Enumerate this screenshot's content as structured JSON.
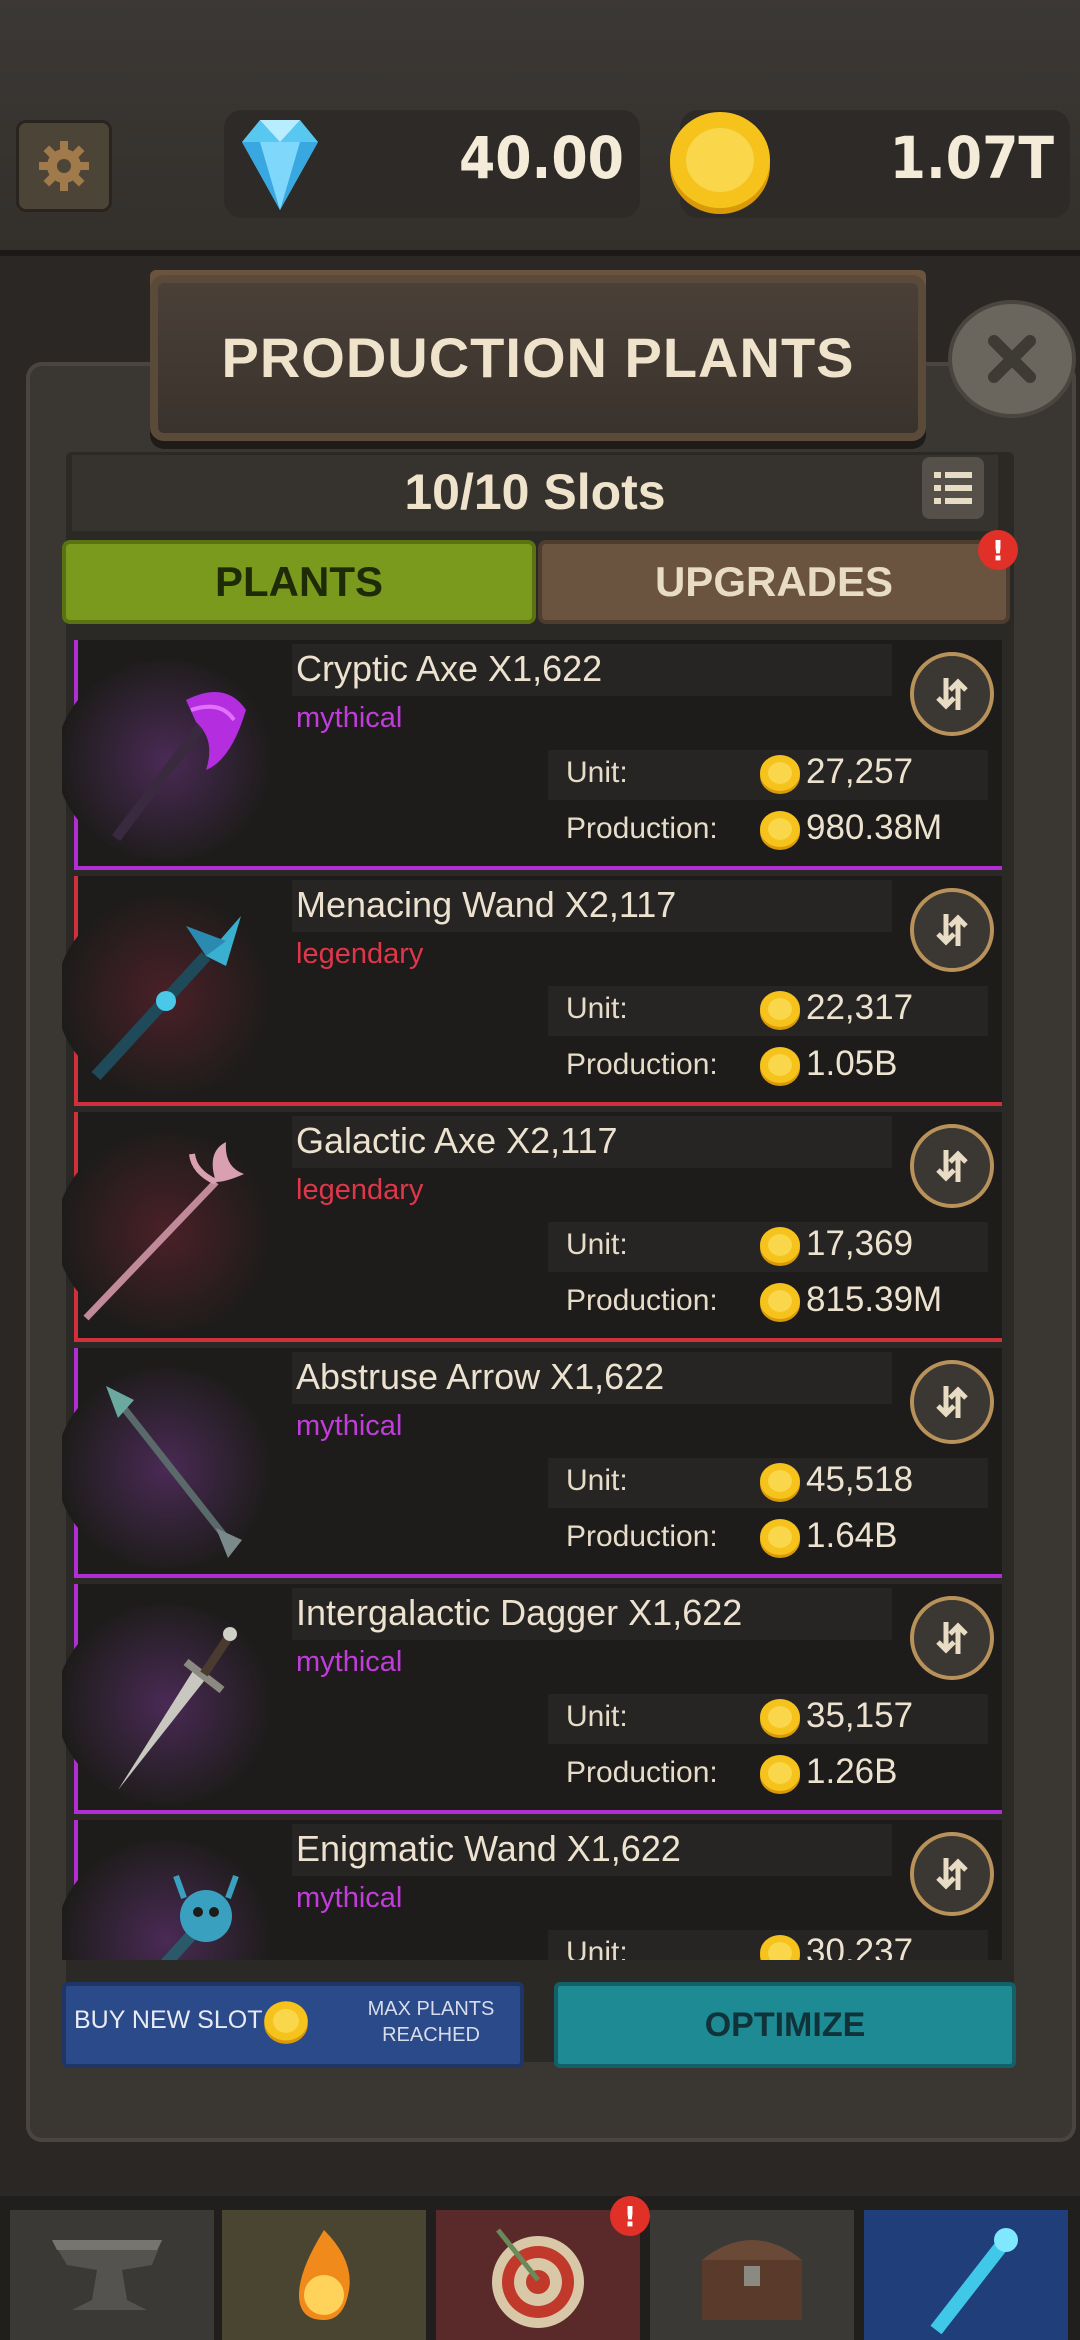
{
  "header": {
    "gems": "40.00",
    "coins": "1.07T"
  },
  "modal": {
    "title": "PRODUCTION PLANTS",
    "slots": "10/10 Slots",
    "tabs": {
      "plants": "PLANTS",
      "upgrades": "UPGRADES"
    },
    "upgrades_badge": "!"
  },
  "items": [
    {
      "name": "Cryptic Axe X1,622",
      "rarity": "mythical",
      "unit_label": "Unit:",
      "unit": "27,257",
      "prod_label": "Production:",
      "production": "980.38M"
    },
    {
      "name": "Menacing Wand X2,117",
      "rarity": "legendary",
      "unit_label": "Unit:",
      "unit": "22,317",
      "prod_label": "Production:",
      "production": "1.05B"
    },
    {
      "name": "Galactic Axe X2,117",
      "rarity": "legendary",
      "unit_label": "Unit:",
      "unit": "17,369",
      "prod_label": "Production:",
      "production": "815.39M"
    },
    {
      "name": "Abstruse Arrow X1,622",
      "rarity": "mythical",
      "unit_label": "Unit:",
      "unit": "45,518",
      "prod_label": "Production:",
      "production": "1.64B"
    },
    {
      "name": "Intergalactic Dagger X1,622",
      "rarity": "mythical",
      "unit_label": "Unit:",
      "unit": "35,157",
      "prod_label": "Production:",
      "production": "1.26B"
    },
    {
      "name": "Enigmatic Wand X1,622",
      "rarity": "mythical",
      "unit_label": "Unit:",
      "unit": "30,237",
      "prod_label": "Production:",
      "production": ""
    }
  ],
  "footer": {
    "buy_label": "BUY NEW SLOT",
    "max_line1": "MAX PLANTS",
    "max_line2": "REACHED",
    "optimize": "OPTIMIZE"
  },
  "nav": {
    "tabs": [
      "anvil-icon",
      "fire-icon",
      "target-icon",
      "chest-icon",
      "wand-icon"
    ],
    "target_badge": "!"
  },
  "colors": {
    "mythical": "#c23cdb",
    "legendary": "#e0364a",
    "plants_tab": "#7a9a1e",
    "optimize": "#1d8a94",
    "buy_slot": "#2a4a8a"
  }
}
